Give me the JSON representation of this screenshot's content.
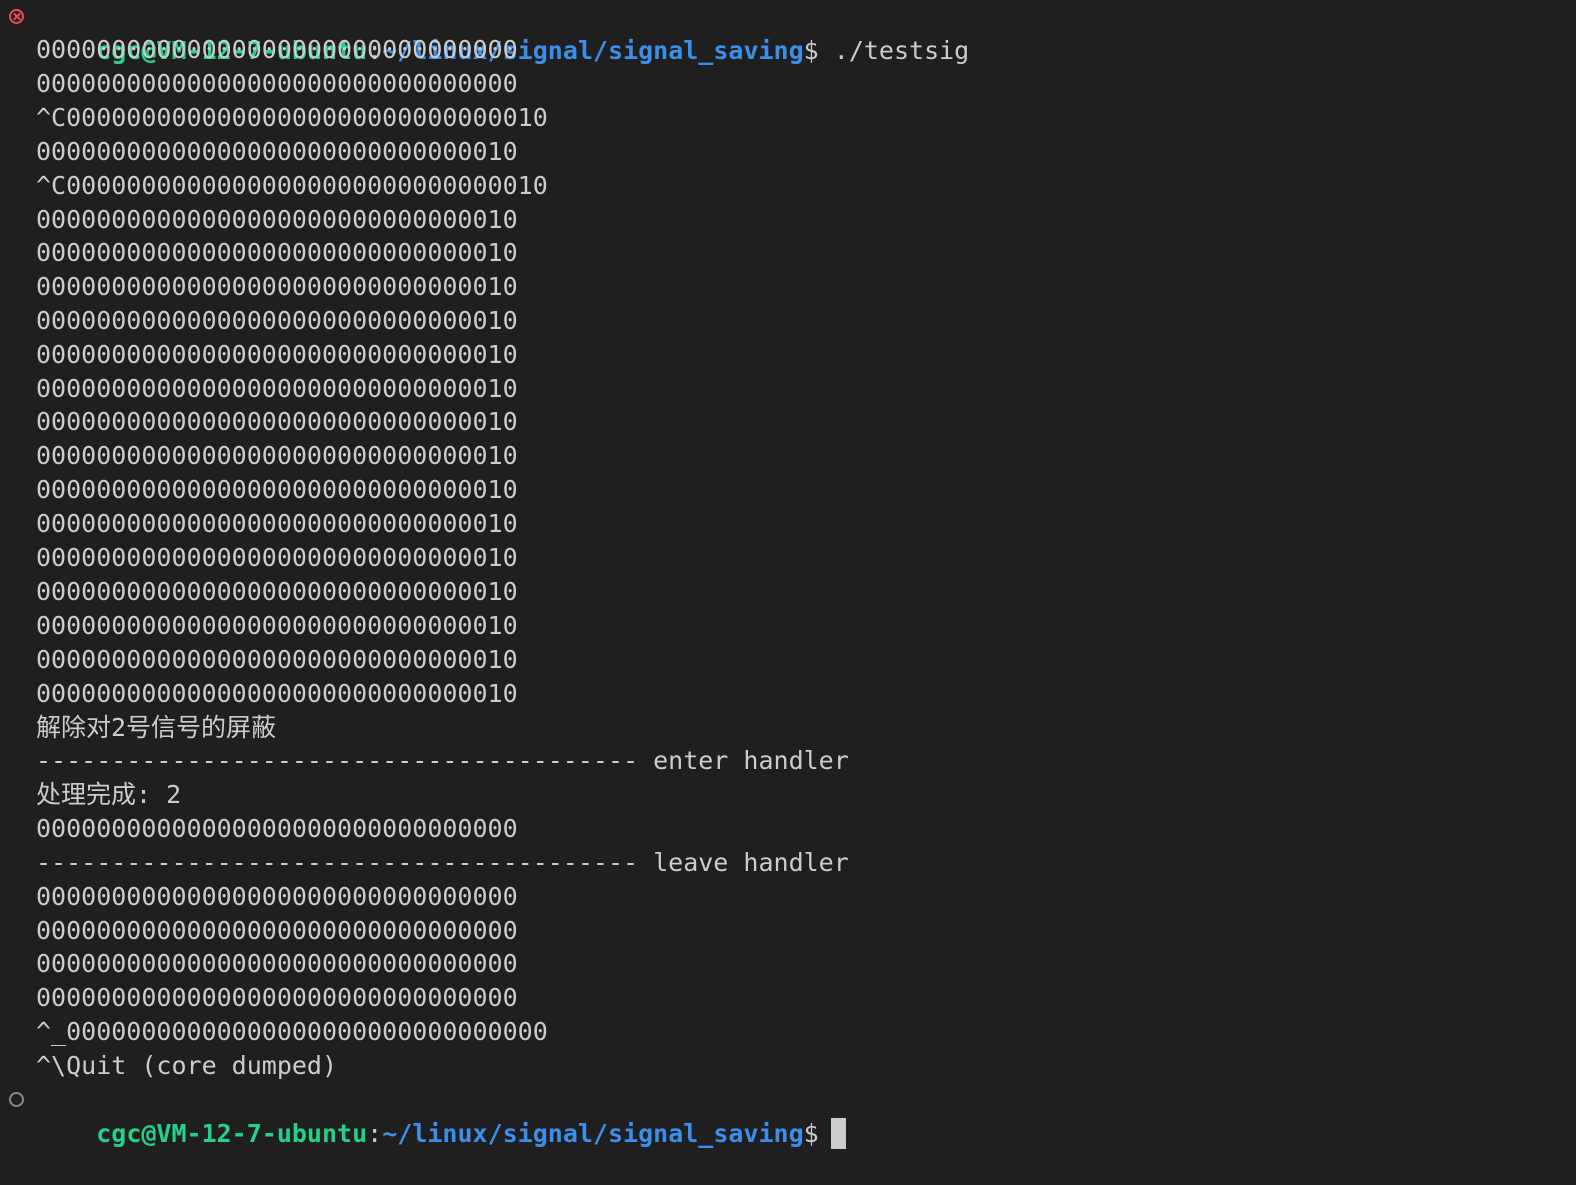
{
  "terminal": {
    "prompt": {
      "user_host": "cgc@VM-12-7-ubuntu",
      "separator": ":",
      "path": "~/linux/signal/signal_saving",
      "dollar": "$",
      "command": " ./testsig"
    },
    "output": [
      "00000000000000000000000000000000",
      "00000000000000000000000000000000",
      "^C00000000000000000000000000000010",
      "00000000000000000000000000000010",
      "^C00000000000000000000000000000010",
      "00000000000000000000000000000010",
      "00000000000000000000000000000010",
      "00000000000000000000000000000010",
      "00000000000000000000000000000010",
      "00000000000000000000000000000010",
      "00000000000000000000000000000010",
      "00000000000000000000000000000010",
      "00000000000000000000000000000010",
      "00000000000000000000000000000010",
      "00000000000000000000000000000010",
      "00000000000000000000000000000010",
      "00000000000000000000000000000010",
      "00000000000000000000000000000010",
      "00000000000000000000000000000010",
      "00000000000000000000000000000010",
      "解除对2号信号的屏蔽",
      "---------------------------------------- enter handler",
      "处理完成: 2",
      "00000000000000000000000000000000",
      "---------------------------------------- leave handler",
      "00000000000000000000000000000000",
      "00000000000000000000000000000000",
      "00000000000000000000000000000000",
      "00000000000000000000000000000000",
      "^_00000000000000000000000000000000",
      "^\\Quit (core dumped)"
    ],
    "final_prompt": {
      "user_host": "cgc@VM-12-7-ubuntu",
      "separator": ":",
      "path": "~/linux/signal/signal_saving",
      "dollar": "$"
    },
    "decorations": {
      "first": "error-circle-icon",
      "last": "default-circle-icon"
    },
    "colors": {
      "background": "#1f1f1f",
      "text": "#cccccc",
      "user_host": "#23d18b",
      "path": "#3b8eea",
      "error": "#f14c4c"
    }
  }
}
